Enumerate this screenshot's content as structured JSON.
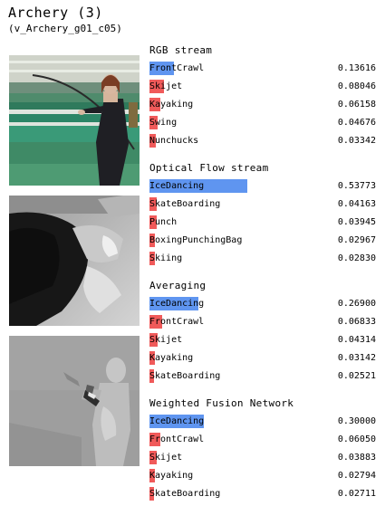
{
  "header": {
    "title": "Archery (3)",
    "subtitle": "(v_Archery_g01_c05)"
  },
  "colors": {
    "top_prediction_bar": "#5f95f0",
    "other_prediction_bar": "#f05a5a"
  },
  "sections": [
    {
      "title": "RGB stream",
      "rows": [
        {
          "label": "FrontCrawl",
          "score": "0.13616",
          "value": 0.13616,
          "top": true
        },
        {
          "label": "Skijet",
          "score": "0.08046",
          "value": 0.08046,
          "top": false
        },
        {
          "label": "Kayaking",
          "score": "0.06158",
          "value": 0.06158,
          "top": false
        },
        {
          "label": "Swing",
          "score": "0.04676",
          "value": 0.04676,
          "top": false
        },
        {
          "label": "Nunchucks",
          "score": "0.03342",
          "value": 0.03342,
          "top": false
        }
      ]
    },
    {
      "title": "Optical Flow stream",
      "rows": [
        {
          "label": "IceDancing",
          "score": "0.53773",
          "value": 0.53773,
          "top": true
        },
        {
          "label": "SkateBoarding",
          "score": "0.04163",
          "value": 0.04163,
          "top": false
        },
        {
          "label": "Punch",
          "score": "0.03945",
          "value": 0.03945,
          "top": false
        },
        {
          "label": "BoxingPunchingBag",
          "score": "0.02967",
          "value": 0.02967,
          "top": false
        },
        {
          "label": "Skiing",
          "score": "0.02830",
          "value": 0.0283,
          "top": false
        }
      ]
    },
    {
      "title": "Averaging",
      "rows": [
        {
          "label": "IceDancing",
          "score": "0.26900",
          "value": 0.269,
          "top": true
        },
        {
          "label": "FrontCrawl",
          "score": "0.06833",
          "value": 0.06833,
          "top": false
        },
        {
          "label": "Skijet",
          "score": "0.04314",
          "value": 0.04314,
          "top": false
        },
        {
          "label": "Kayaking",
          "score": "0.03142",
          "value": 0.03142,
          "top": false
        },
        {
          "label": "SkateBoarding",
          "score": "0.02521",
          "value": 0.02521,
          "top": false
        }
      ]
    },
    {
      "title": "Weighted Fusion Network",
      "rows": [
        {
          "label": "IceDancing",
          "score": "0.30000",
          "value": 0.3,
          "top": true
        },
        {
          "label": "FrontCrawl",
          "score": "0.06050",
          "value": 0.0605,
          "top": false
        },
        {
          "label": "Skijet",
          "score": "0.03883",
          "value": 0.03883,
          "top": false
        },
        {
          "label": "Kayaking",
          "score": "0.02794",
          "value": 0.02794,
          "top": false
        },
        {
          "label": "SkateBoarding",
          "score": "0.02711",
          "value": 0.02711,
          "top": false
        }
      ]
    }
  ]
}
